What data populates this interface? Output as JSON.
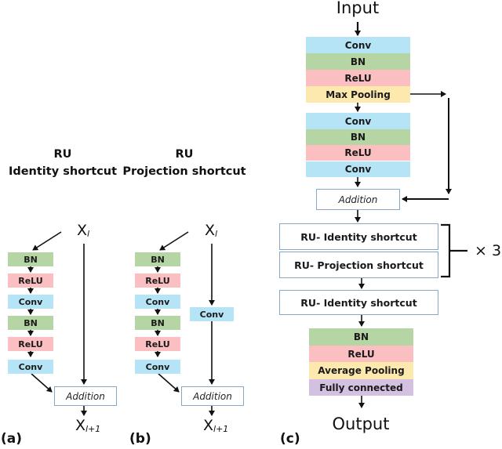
{
  "panel_a": {
    "label": "(a)",
    "title_line1": "RU",
    "title_line2": "Identity shortcut",
    "input_var": "X",
    "input_sub": "l",
    "output_var": "X",
    "output_sub": "l+1",
    "blocks": [
      "BN",
      "ReLU",
      "Conv",
      "BN",
      "ReLU",
      "Conv"
    ],
    "addition": "Addition"
  },
  "panel_b": {
    "label": "(b)",
    "title_line1": "RU",
    "title_line2": "Projection shortcut",
    "input_var": "X",
    "input_sub": "l",
    "output_var": "X",
    "output_sub": "l+1",
    "blocks": [
      "BN",
      "ReLU",
      "Conv",
      "BN",
      "ReLU",
      "Conv"
    ],
    "shortcut_block": "Conv",
    "addition": "Addition"
  },
  "panel_c": {
    "label": "(c)",
    "input": "Input",
    "output": "Output",
    "stem": [
      "Conv",
      "BN",
      "ReLU",
      "Max  Pooling"
    ],
    "body": [
      "Conv",
      "BN",
      "ReLU",
      "Conv"
    ],
    "addition": "Addition",
    "ru_identity": "RU- Identity shortcut",
    "ru_projection": "RU- Projection shortcut",
    "repeat": "× 3",
    "ru_identity_final": "RU- Identity shortcut",
    "head": [
      "BN",
      "ReLU",
      "Average  Pooling",
      "Fully connected"
    ]
  },
  "colors": {
    "conv": "#b4e4f6",
    "bn": "#b6d5a4",
    "relu": "#fbbfc1",
    "pooling": "#fde8ae",
    "fully_connected": "#d4c0e1",
    "outline": "#8aa7c4"
  }
}
